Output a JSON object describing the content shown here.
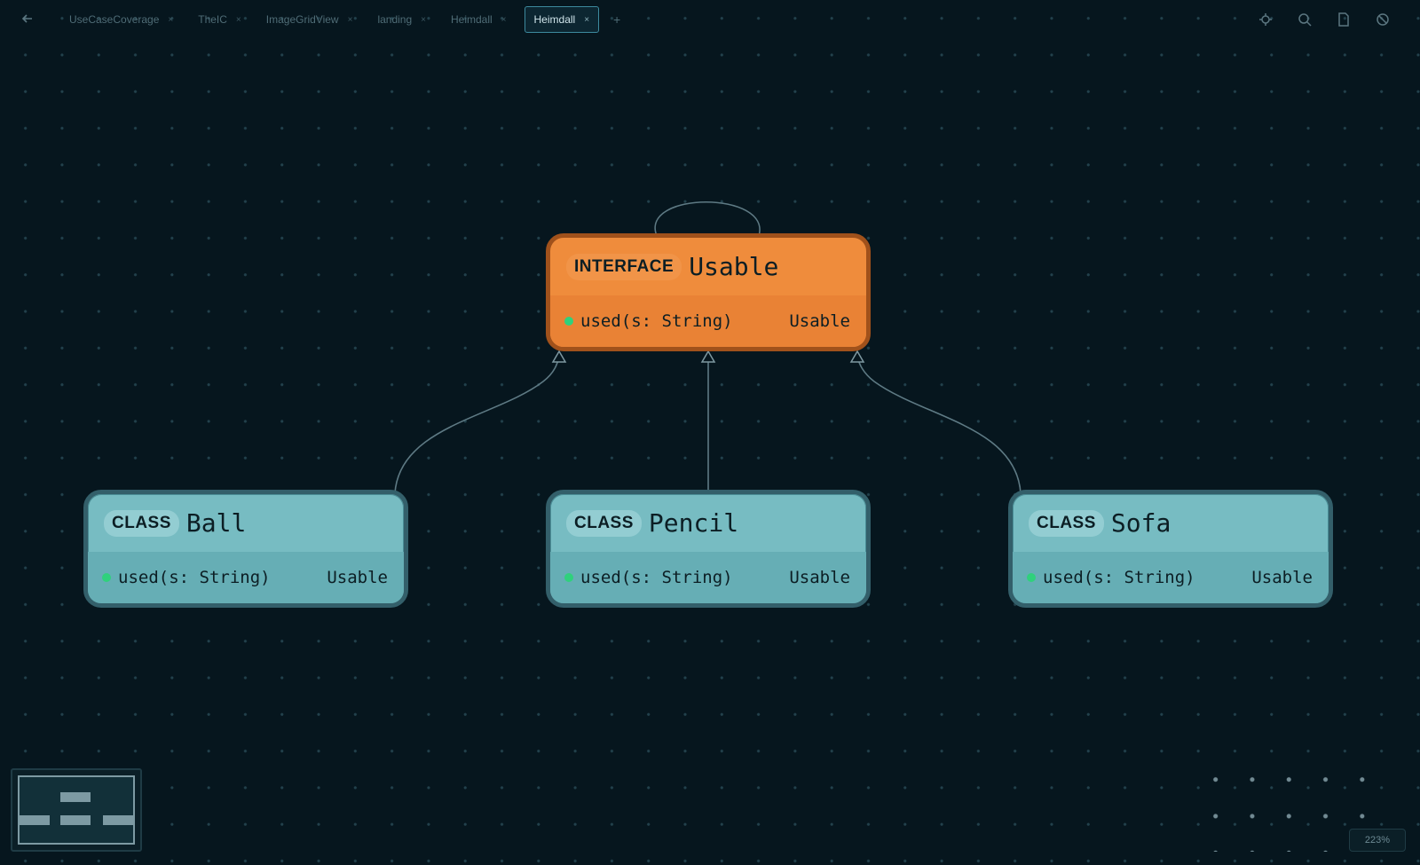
{
  "topbar": {
    "back_icon": "arrow-left-icon",
    "tabs": [
      {
        "label": "UseCaseCoverage",
        "active": false
      },
      {
        "label": "TheIC",
        "active": false
      },
      {
        "label": "ImageGridView",
        "active": false
      },
      {
        "label": "landing",
        "active": false
      },
      {
        "label": "Heimdall",
        "active": false
      },
      {
        "label": "Heimdall",
        "active": true
      }
    ],
    "tab_close_glyph": "×",
    "add_tab_glyph": "+",
    "icons": [
      "settings-icon",
      "search-icon",
      "document-icon",
      "block-icon"
    ]
  },
  "nodes": [
    {
      "kind": "INTERFACE",
      "name": "Usable",
      "method": "used(s: String)",
      "owner": "Usable",
      "color": "#ef8c3c"
    },
    {
      "kind": "CLASS",
      "name": "Ball",
      "method": "used(s: String)",
      "owner": "Usable",
      "color": "#77bcc2"
    },
    {
      "kind": "CLASS",
      "name": "Pencil",
      "method": "used(s: String)",
      "owner": "Usable",
      "color": "#77bcc2"
    },
    {
      "kind": "CLASS",
      "name": "Sofa",
      "method": "used(s: String)",
      "owner": "Usable",
      "color": "#77bcc2"
    }
  ],
  "edges": [
    {
      "from": "Ball",
      "to": "Usable",
      "type": "implements"
    },
    {
      "from": "Pencil",
      "to": "Usable",
      "type": "implements"
    },
    {
      "from": "Sofa",
      "to": "Usable",
      "type": "implements"
    },
    {
      "from": "Usable",
      "to": "Usable",
      "type": "self-reference"
    }
  ],
  "zoom": {
    "label": "223%"
  },
  "colors": {
    "canvas_bg": "#06161e",
    "method_dot": "#2fd17c",
    "edge": "#5e7a84"
  }
}
